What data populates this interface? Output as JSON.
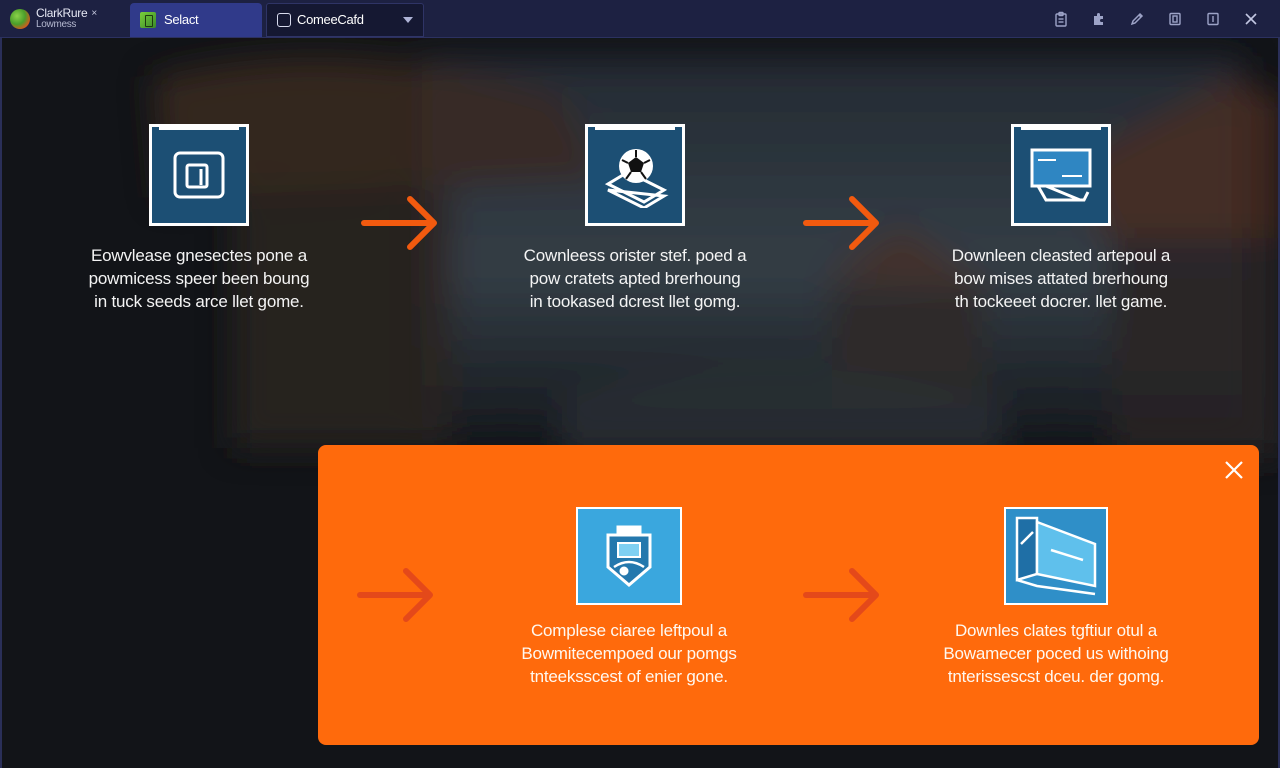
{
  "titlebar": {
    "brand_name": "ClarkRure",
    "brand_sub": "Lowmess",
    "brand_close": "×",
    "tabs": [
      {
        "label": "Selact",
        "icon": "green-app-icon"
      },
      {
        "label": "ComeeCafd",
        "icon": "window-icon"
      }
    ],
    "window_icons": [
      "clipboard-icon",
      "puzzle-icon",
      "pen-icon",
      "restore-icon",
      "minimize-icon",
      "close-icon"
    ]
  },
  "steps_top": [
    {
      "icon": "sd-card-icon",
      "lines": [
        "Eowvlease gnesectes pone a",
        "powmicess speer been boung",
        "in tuck seeds arce llet gome."
      ]
    },
    {
      "icon": "football-tray-icon",
      "lines": [
        "Cownleess orister stef. poed a",
        "pow cratets apted brerhoung",
        "in tookased dcrest llet gomg."
      ]
    },
    {
      "icon": "monitor-icon",
      "lines": [
        "Downleen cleasted artepoul a",
        "bow mises attated brerhoung",
        "th tockeeet docrer. llet game."
      ]
    }
  ],
  "panel": {
    "close_icon": "close-icon",
    "steps": [
      {
        "icon": "id-badge-icon",
        "lines": [
          "Complese ciaree leftpoul a",
          "Bowmitecempoed our pomgs",
          "tnteeksscest of enier gone."
        ]
      },
      {
        "icon": "screens-icon",
        "lines": [
          "Downles clates tgftiur otul a",
          "Bowamecer poced us withoing",
          "tnterissescst dceu. der gomg."
        ]
      }
    ]
  },
  "colors": {
    "accent": "#ff6a0c",
    "titlebar": "#1d2142",
    "tile_dark": "#1c4f74",
    "tile_light": "#3aa7de"
  }
}
